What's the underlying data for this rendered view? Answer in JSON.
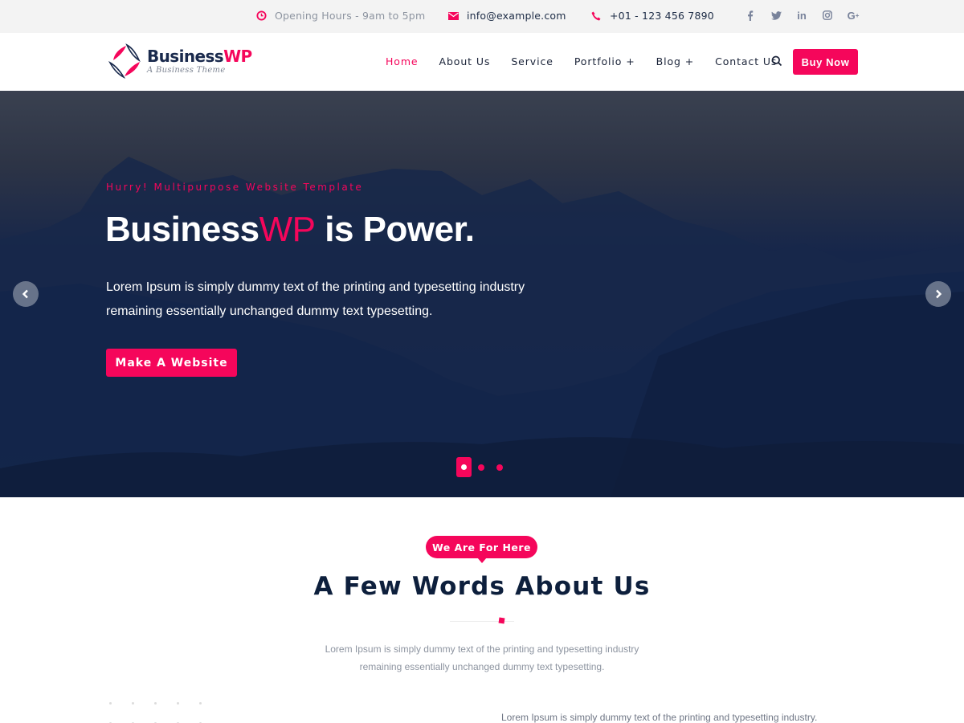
{
  "colors": {
    "accent": "#f5065b",
    "navy": "#0d1f3c",
    "topbar_bg": "#f3f3f3"
  },
  "topbar": {
    "hours": {
      "icon": "clock-icon",
      "text": "Opening Hours - 9am to 5pm"
    },
    "email": {
      "icon": "envelope-icon",
      "text": "info@example.com"
    },
    "phone": {
      "icon": "phone-icon",
      "text": "+01 - 123 456 7890"
    },
    "social": [
      {
        "name": "facebook",
        "glyph": "f"
      },
      {
        "name": "twitter",
        "glyph": "t"
      },
      {
        "name": "linkedin",
        "glyph": "in"
      },
      {
        "name": "instagram",
        "glyph": "ig"
      },
      {
        "name": "google-plus",
        "glyph": "G+"
      }
    ]
  },
  "header": {
    "logo": {
      "name_main": "Business",
      "name_accent": "WP",
      "tagline": "A Business Theme"
    },
    "nav": [
      {
        "label": "Home",
        "active": true
      },
      {
        "label": "About Us",
        "active": false
      },
      {
        "label": "Service",
        "active": false
      },
      {
        "label": "Portfolio +",
        "active": false
      },
      {
        "label": "Blog +",
        "active": false
      },
      {
        "label": "Contact Us",
        "active": false
      }
    ],
    "search_icon": "search-icon",
    "buy_label": "Buy Now"
  },
  "hero": {
    "subtitle": "Hurry! Multipurpose Website Template",
    "title_main": "Business",
    "title_accent": "WP",
    "title_rest": " is Power.",
    "text_line1": "Lorem Ipsum is simply dummy text of the printing and typesetting industry",
    "text_line2": "remaining essentially unchanged dummy text typesetting.",
    "cta_label": "Make A Website",
    "slides_total": 3,
    "active_slide": 1
  },
  "about": {
    "badge": "We Are For Here",
    "title": "A Few Words About Us",
    "text_line1": "Lorem Ipsum is simply dummy text of the printing and typesetting industry",
    "text_line2": "remaining essentially unchanged dummy text typesetting.",
    "side_text": "Lorem Ipsum is simply dummy text of the printing and typesetting industry."
  }
}
